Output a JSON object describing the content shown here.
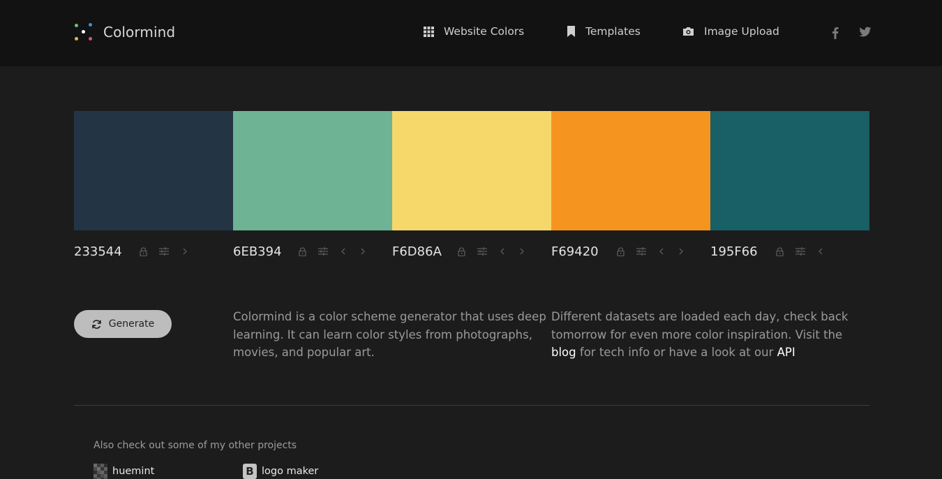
{
  "header": {
    "brand": "Colormind",
    "nav": [
      {
        "label": "Website Colors",
        "icon": "grid-icon"
      },
      {
        "label": "Templates",
        "icon": "bookmark-icon"
      },
      {
        "label": "Image Upload",
        "icon": "camera-icon"
      }
    ],
    "social": [
      {
        "icon": "facebook-icon"
      },
      {
        "icon": "twitter-icon"
      }
    ]
  },
  "palette": {
    "swatches": [
      {
        "hex": "233544",
        "color": "#233544"
      },
      {
        "hex": "6EB394",
        "color": "#6EB394"
      },
      {
        "hex": "F6D86A",
        "color": "#F6D86A"
      },
      {
        "hex": "F69420",
        "color": "#F69420"
      },
      {
        "hex": "195F66",
        "color": "#195F66"
      }
    ]
  },
  "actions": {
    "generate_label": "Generate"
  },
  "about": {
    "left_lines": [
      "Colormind is a color scheme generator that uses deep",
      "learning. It can learn color styles from photographs,",
      "movies, and popular art."
    ],
    "right_line1": "Different datasets are loaded each day, check back",
    "right_line2": "tomorrow for even more color inspiration. Visit the",
    "blog_link": "blog",
    "right_mid": " for tech info or have a look at our ",
    "api_link": "API"
  },
  "footer": {
    "also_text": "Also check out some of my other projects",
    "projects": [
      {
        "label": "huemint",
        "icon": "huemint-logo-icon"
      },
      {
        "label": "logo maker",
        "icon": "logo-maker-b-icon"
      }
    ]
  },
  "colors": {
    "topbar": "#121212",
    "background": "#1c1c1c",
    "button": "#bdbdbd",
    "icon_muted": "#5a5a5a"
  }
}
